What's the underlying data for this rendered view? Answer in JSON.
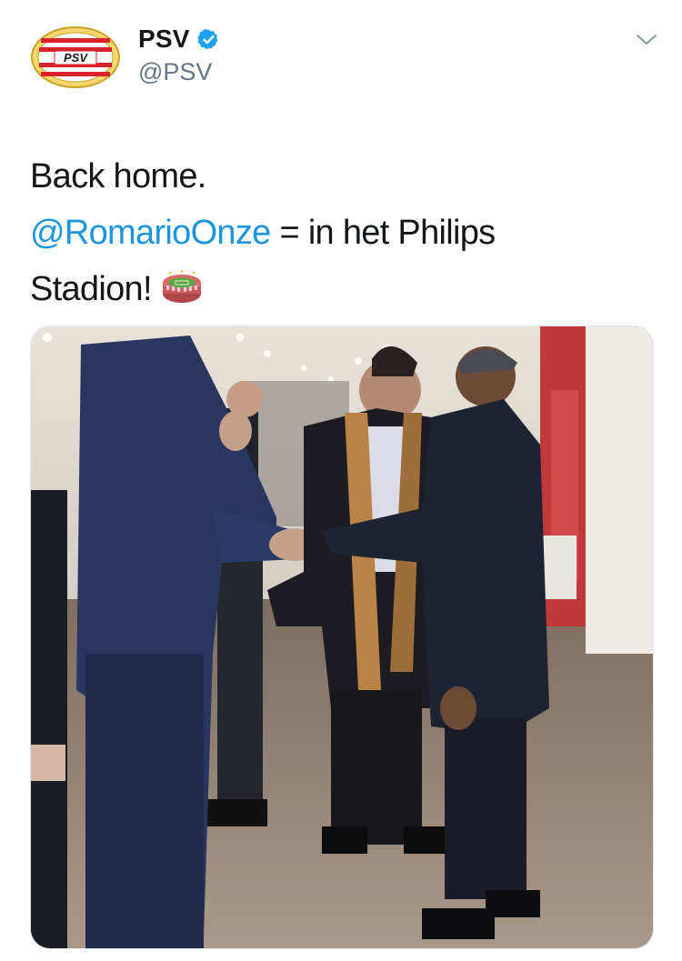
{
  "account": {
    "display_name": "PSV",
    "handle": "@PSV",
    "avatar_logo_text": "PSV",
    "verified": true,
    "verified_color": "#1da1f2"
  },
  "icons": {
    "verified": "verified-badge-icon",
    "menu": "chevron-down-icon",
    "emoji": "stadium-emoji-icon"
  },
  "tweet": {
    "line1": "Back home.",
    "mention": "@RomarioOnze",
    "line2_rest": " = in het Philips",
    "line3": "Stadion!",
    "link_color": "#1b95e0"
  },
  "media": {
    "type": "video",
    "description_visible": false
  }
}
